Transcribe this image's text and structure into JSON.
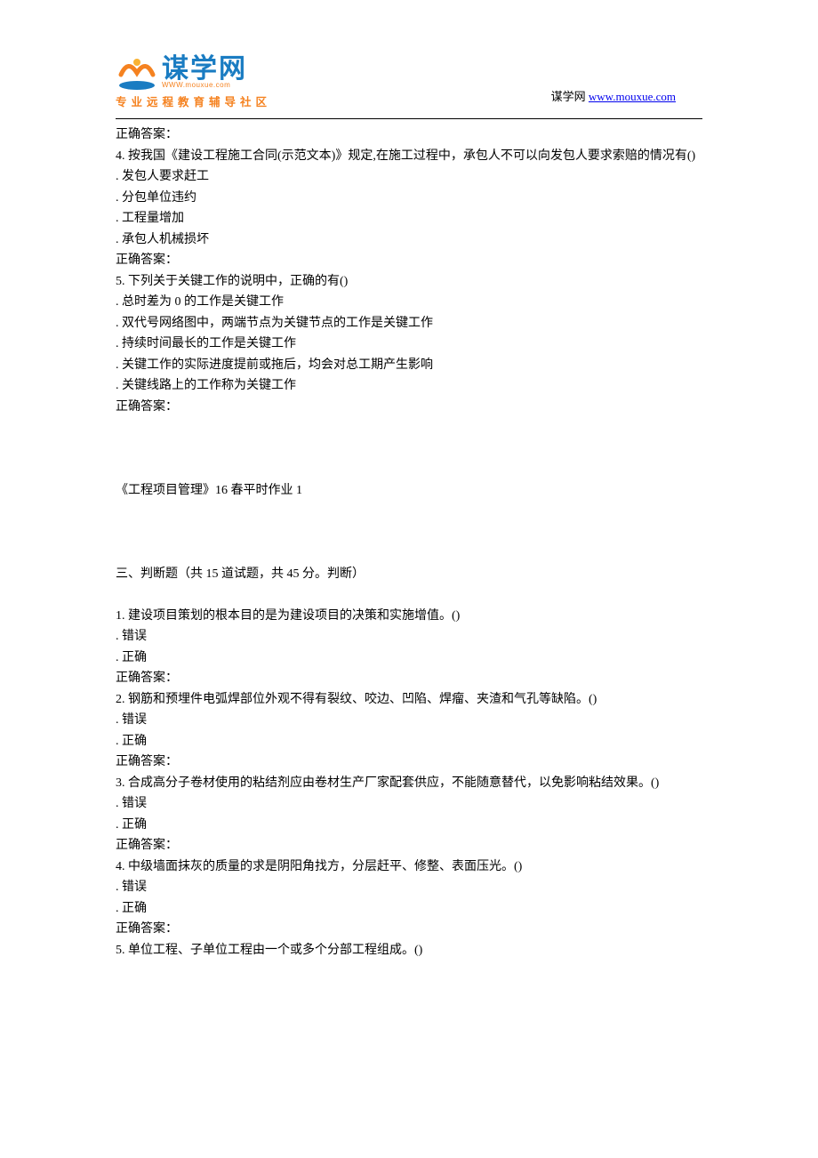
{
  "header": {
    "logo_cn": "谋学网",
    "logo_url": "WWW.mouxue.com",
    "logo_tag": "专业远程教育辅导社区",
    "right_prefix": "谋学网 ",
    "right_link": "www.mouxue.com"
  },
  "body_lines": [
    "正确答案：",
    "4.   按我国《建设工程施工合同(示范文本)》规定,在施工过程中，承包人不可以向发包人要求索赔的情况有()",
    ". 发包人要求赶工",
    ". 分包单位违约",
    ". 工程量增加",
    ". 承包人机械损坏",
    "正确答案：",
    "5.   下列关于关键工作的说明中，正确的有()",
    ". 总时差为 0 的工作是关键工作",
    ". 双代号网络图中，两端节点为关键节点的工作是关键工作",
    ". 持续时间最长的工作是关键工作",
    ". 关键工作的实际进度提前或拖后，均会对总工期产生影响",
    ". 关键线路上的工作称为关键工作",
    "正确答案：",
    "",
    "",
    "",
    " 《工程项目管理》16 春平时作业 1",
    "",
    "",
    "",
    "三、判断题（共 15 道试题，共 45 分。判断）",
    "",
    "1.   建设项目策划的根本目的是为建设项目的决策和实施增值。()",
    ". 错误",
    ". 正确",
    "正确答案：",
    "2.   钢筋和预埋件电弧焊部位外观不得有裂纹、咬边、凹陷、焊瘤、夹渣和气孔等缺陷。()",
    ". 错误",
    ". 正确",
    "正确答案：",
    "3.   合成高分子卷材使用的粘结剂应由卷材生产厂家配套供应，不能随意替代，以免影响粘结效果。()",
    ". 错误",
    ". 正确",
    "正确答案：",
    "4.   中级墙面抹灰的质量的求是阴阳角找方，分层赶平、修整、表面压光。()",
    ". 错误",
    ". 正确",
    "正确答案：",
    "5.   单位工程、子单位工程由一个或多个分部工程组成。()"
  ]
}
